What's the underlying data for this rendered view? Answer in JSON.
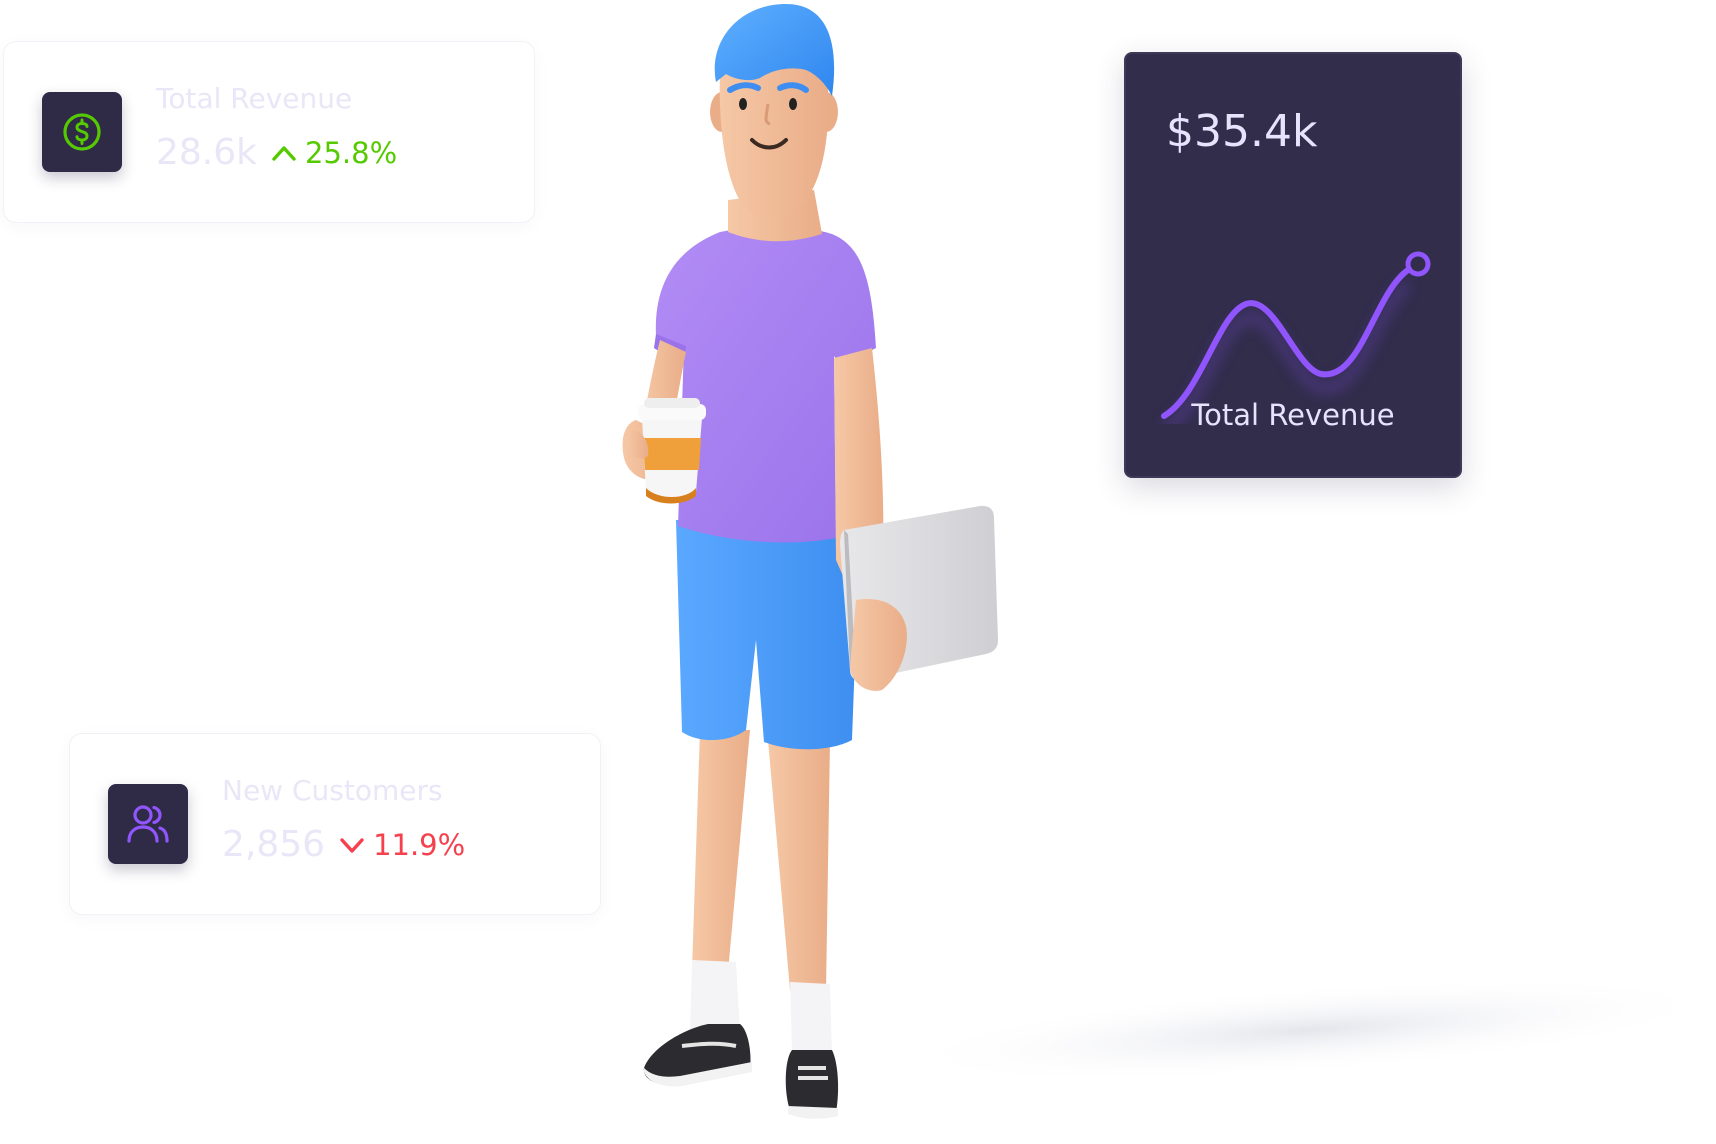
{
  "revenue_card": {
    "label": "Total Revenue",
    "value": "28.6k",
    "change": "25.8%",
    "trend": "up",
    "icon": "dollar-circle-icon"
  },
  "customers_card": {
    "label": "New Customers",
    "value": "2,856",
    "change": "11.9%",
    "trend": "down",
    "icon": "users-icon"
  },
  "dark_card": {
    "amount": "$35.4k",
    "label": "Total Revenue"
  },
  "colors": {
    "card_dark": "#312d4b",
    "icon_bg": "#2f2b47",
    "accent_purple": "#9155fd",
    "success": "#56ca00",
    "error": "#f5414d",
    "muted_text": "#e9e7f7"
  },
  "illustration": {
    "character": "3d-person-holding-coffee-and-tablet"
  }
}
